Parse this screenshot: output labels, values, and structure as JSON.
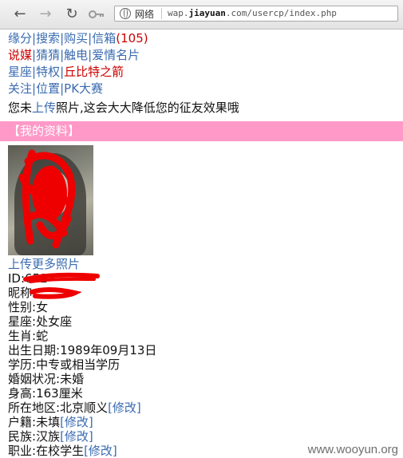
{
  "browser": {
    "address_label": "网络",
    "url_domain_prefix": "wap.",
    "url_domain": "jiayuan",
    "url_domain_suffix": ".com/usercp/index.php"
  },
  "nav": {
    "row1": [
      "缘分",
      "搜索",
      "购买",
      "信箱"
    ],
    "inbox_count": "(105)",
    "row2": [
      "说媒",
      "猜猜",
      "触电",
      "爱情名片"
    ],
    "row3": [
      "星座",
      "特权",
      "丘比特之箭"
    ],
    "row4": [
      "关注",
      "位置",
      "PK大赛"
    ],
    "separator": "|"
  },
  "notice": {
    "before": "您未",
    "link": "上传",
    "after": "照片,这会大大降低您的征友效果哦"
  },
  "section_title": "【我的资料】",
  "profile": {
    "upload_more": "上传更多照片",
    "id_label": "ID:",
    "id_value": "652",
    "nickname_label": "昵称",
    "gender_label": "性别:",
    "gender_value": "女",
    "zodiac_label": "星座:",
    "zodiac_value": "处女座",
    "shengxiao_label": "生肖:",
    "shengxiao_value": "蛇",
    "birthday_label": "出生日期:",
    "birthday_value": "1989年09月13日",
    "education_label": "学历:",
    "education_value": "中专或相当学历",
    "marital_label": "婚姻状况:",
    "marital_value": "未婚",
    "height_label": "身高:",
    "height_value": "163厘米",
    "location_label": "所在地区:",
    "location_value": "北京顺义",
    "hukou_label": "户籍:",
    "hukou_value": "未填",
    "ethnicity_label": "民族:",
    "ethnicity_value": "汉族",
    "job_label": "职业:",
    "job_value": "在校学生",
    "edit_link": "[修改]"
  },
  "watermark": "www.wooyun.org",
  "colors": {
    "link": "#3a6bb0",
    "highlight": "#cc0000",
    "section_bar": "#ff99c8",
    "redaction": "#ee0000"
  },
  "icons": [
    "back-arrow-icon",
    "forward-arrow-icon",
    "refresh-icon",
    "key-icon",
    "globe-icon"
  ]
}
